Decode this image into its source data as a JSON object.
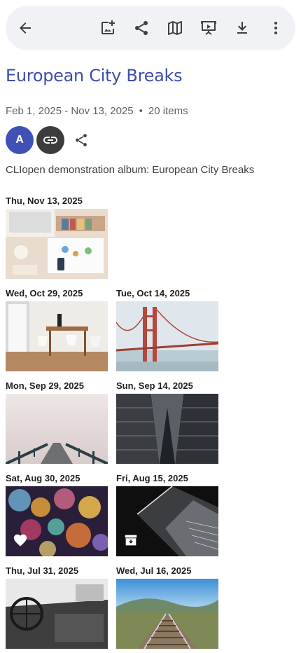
{
  "album": {
    "title": "European City Breaks",
    "date_range": "Feb 1, 2025 - Nov 13, 2025",
    "separator": "•",
    "item_count": "20 items",
    "owner_initial": "A",
    "description": "CLIopen demonstration album: European City Breaks"
  },
  "toolbar": {
    "icons": [
      "back-arrow-icon",
      "add-photo-icon",
      "share-icon",
      "map-icon",
      "slideshow-icon",
      "download-icon",
      "more-vert-icon"
    ]
  },
  "days": [
    {
      "date": "Thu, Nov 13, 2025",
      "photo": "desk-flatlay"
    },
    {
      "date": "Wed, Oct 29, 2025",
      "photo": "dining-room"
    },
    {
      "date": "Tue, Oct 14, 2025",
      "photo": "golden-gate-bridge"
    },
    {
      "date": "Mon, Sep 29, 2025",
      "photo": "foggy-pier"
    },
    {
      "date": "Sun, Sep 14, 2025",
      "photo": "skyscrapers"
    },
    {
      "date": "Sat, Aug 30, 2025",
      "photo": "bokeh-lights",
      "overlay": "favorite-heart-icon"
    },
    {
      "date": "Fri, Aug 15, 2025",
      "photo": "dark-building",
      "overlay": "archive-icon"
    },
    {
      "date": "Thu, Jul 31, 2025",
      "photo": "vintage-car-interior"
    },
    {
      "date": "Wed, Jul 16, 2025",
      "photo": "railway-tracks"
    }
  ],
  "colors": {
    "title": "#3c4eaa",
    "avatar": "#3f51b5",
    "toolbar_bg": "#f0f2f5"
  }
}
